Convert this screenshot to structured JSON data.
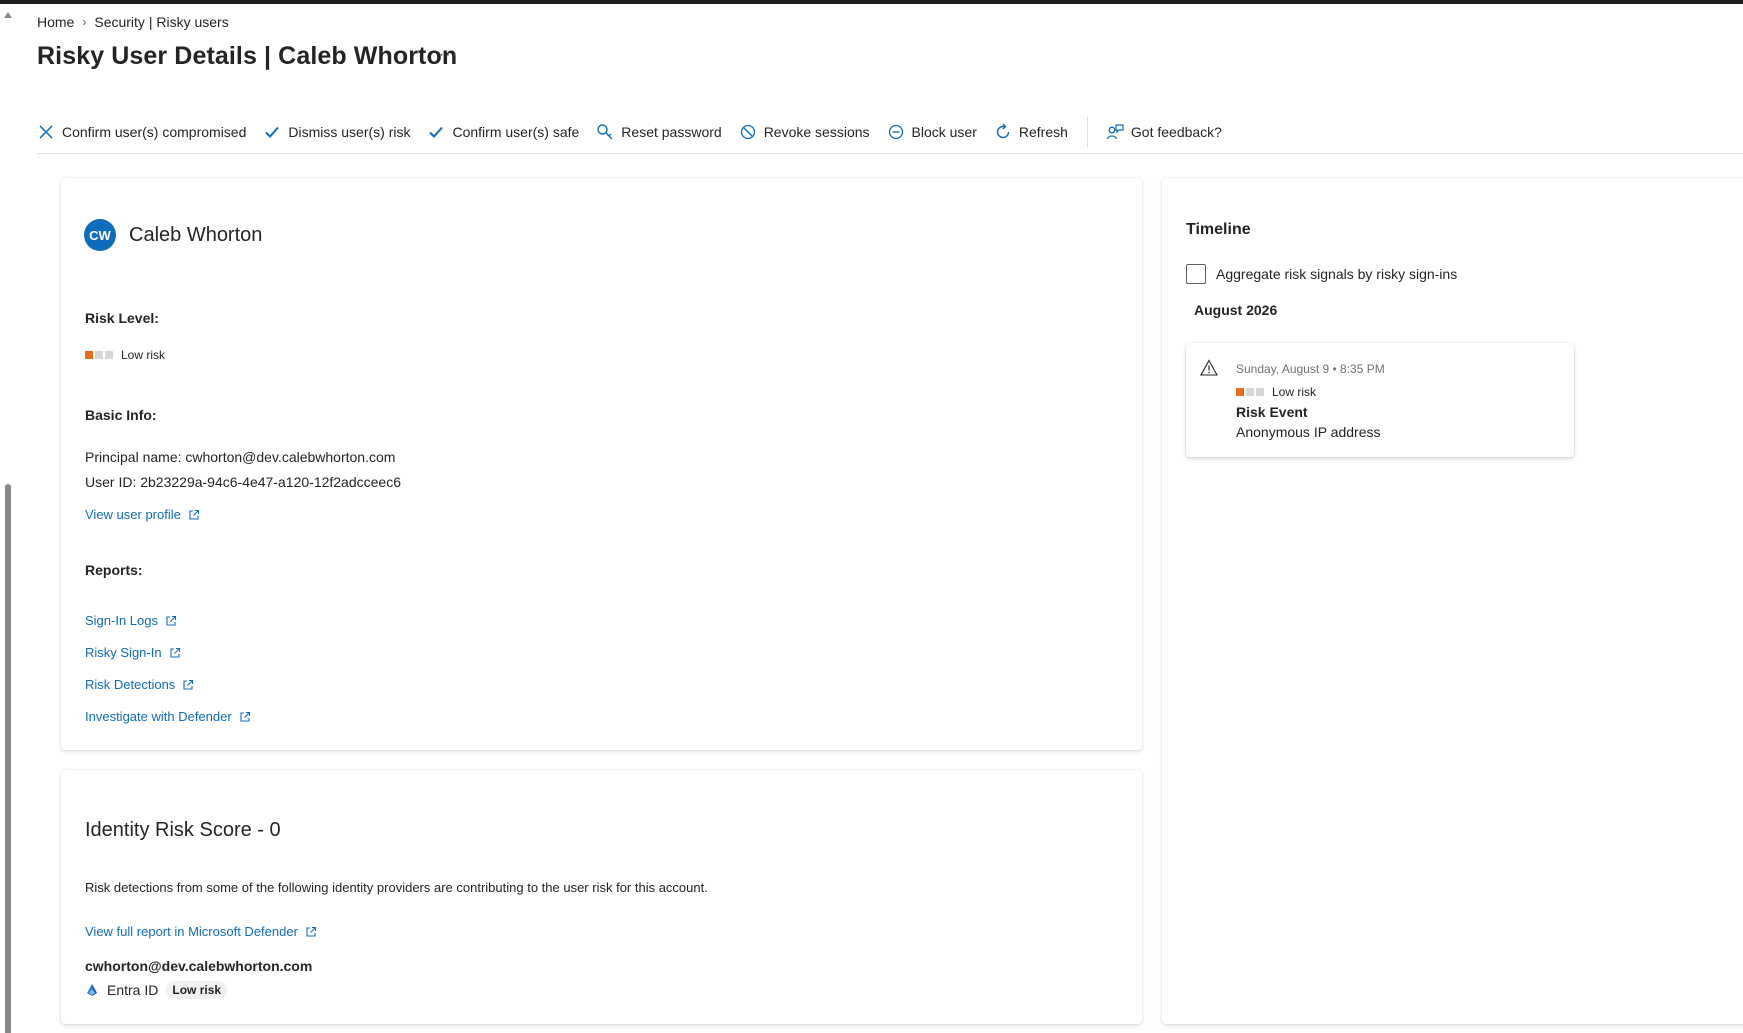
{
  "breadcrumb": {
    "home": "Home",
    "separator": "›",
    "current": "Security | Risky users"
  },
  "page": {
    "title": "Risky User Details | Caleb Whorton",
    "more_label": "···"
  },
  "toolbar": {
    "confirm_compromised": "Confirm user(s) compromised",
    "dismiss_risk": "Dismiss user(s) risk",
    "confirm_safe": "Confirm user(s) safe",
    "reset_password": "Reset password",
    "revoke_sessions": "Revoke sessions",
    "block_user": "Block user",
    "refresh": "Refresh",
    "feedback": "Got feedback?"
  },
  "user": {
    "initials": "CW",
    "name": "Caleb Whorton",
    "risk_level_label": "Risk Level:",
    "risk_level": "Low risk",
    "basic_info_label": "Basic Info:",
    "principal_name": "Principal name: cwhorton@dev.calebwhorton.com",
    "user_id": "User ID: 2b23229a-94c6-4e47-a120-12f2adcceec6",
    "view_profile": "View user profile",
    "reports_label": "Reports:",
    "reports": {
      "sign_in_logs": "Sign-In Logs",
      "risky_sign_in": "Risky Sign-In",
      "risk_detections": "Risk Detections",
      "investigate_defender": "Investigate with Defender"
    }
  },
  "identity_score": {
    "title": "Identity Risk Score - 0",
    "description": "Risk detections from some of the following identity providers are contributing to the user risk for this account.",
    "full_report_link": "View full report in Microsoft Defender",
    "email": "cwhorton@dev.calebwhorton.com",
    "provider": "Entra ID",
    "provider_risk": "Low risk"
  },
  "timeline": {
    "title": "Timeline",
    "aggregate_label": "Aggregate risk signals by risky sign-ins",
    "aggregate_checked": false,
    "month": "August 2026",
    "event": {
      "date": "Sunday, August 9 • 8:35 PM",
      "risk": "Low risk",
      "type": "Risk Event",
      "description": "Anonymous IP address"
    }
  },
  "colors": {
    "accent": "#0f6cbd",
    "risk_low": "#e86b1c",
    "risk_inactive": "#d6d6d6"
  },
  "icons": {
    "warning": "warning-triangle-icon",
    "external": "open-external-icon"
  }
}
